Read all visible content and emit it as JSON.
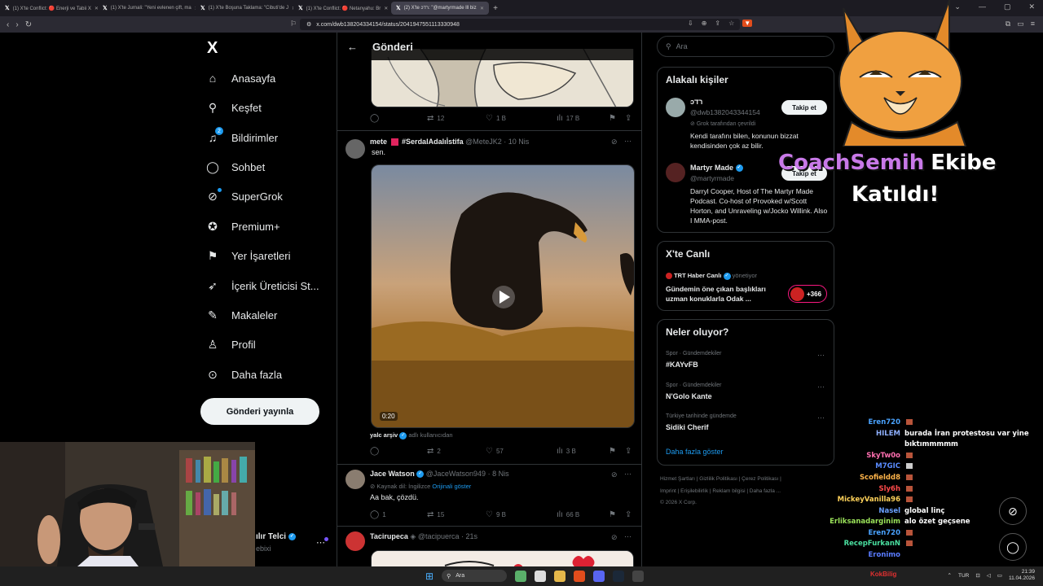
{
  "browser": {
    "tabs": [
      {
        "label": "(1) X'te Conflict: 🔴 Enerji ve Tabii X"
      },
      {
        "label": "(1) X'te Jurnali: \"Yeni evlenen çift, ma"
      },
      {
        "label": "(1) X'te Boşuna Taklama: \"Cibuti'de J"
      },
      {
        "label": "(1) X'te Conflict: 🔴 Netanyahu: Br"
      },
      {
        "label": "(2) X'te ɔרד: \"@martyrmade lll biz"
      }
    ],
    "url": "x.com/dwb1382043341​54/status/2041947551113330948"
  },
  "sidebar": {
    "logo": "X",
    "items": [
      {
        "label": "Anasayfa",
        "icon": "home-icon",
        "glyph": "⌂"
      },
      {
        "label": "Keşfet",
        "icon": "search-icon",
        "glyph": "⚲"
      },
      {
        "label": "Bildirimler",
        "icon": "bell-icon",
        "glyph": "🔔",
        "badge": "2"
      },
      {
        "label": "Sohbet",
        "icon": "chat-icon",
        "glyph": "◯"
      },
      {
        "label": "SuperGrok",
        "icon": "grok-icon",
        "glyph": "⊘"
      },
      {
        "label": "Premium+",
        "icon": "premium-icon",
        "glyph": "✪"
      },
      {
        "label": "Yer İşaretleri",
        "icon": "bookmark-icon",
        "glyph": "⚑"
      },
      {
        "label": "İçerik Üreticisi St...",
        "icon": "rocket-icon",
        "glyph": "➶"
      },
      {
        "label": "Makaleler",
        "icon": "article-icon",
        "glyph": "✎"
      },
      {
        "label": "Profil",
        "icon": "person-icon",
        "glyph": "👤"
      },
      {
        "label": "Daha fazla",
        "icon": "more-icon",
        "glyph": "⋯"
      }
    ],
    "post_button": "Gönderi yayınla",
    "account_name": "ılır Telci",
    "account_handle": "ebixi"
  },
  "main": {
    "header_title": "Gönderi",
    "top_post_actions": {
      "replies": "",
      "reposts": "12",
      "likes": "1 B",
      "views": "17 B"
    },
    "post1": {
      "name": "mete",
      "hashtag": "#SerdalAdalıİstifa",
      "handle": "@MeteJK2",
      "time": "10 Nis",
      "text": "sen.",
      "video_time": "0:20",
      "source_name": "yalc arşiv",
      "source_suffix": "adlı kullanıcıdan",
      "actions": {
        "replies": "",
        "reposts": "2",
        "likes": "57",
        "views": "3 B"
      }
    },
    "post2": {
      "name": "Jace Watson",
      "handle": "@JaceWatson949",
      "time": "8 Nis",
      "translate_note": "Kaynak dil: İngilizce",
      "translate_link": "Orijinali göster",
      "text": "Aa bak, çözdü.",
      "actions": {
        "replies": "1",
        "reposts": "15",
        "likes": "9 B",
        "views": "66 B"
      }
    },
    "post3": {
      "name": "Tacirupeca",
      "handle": "@tacipuerca",
      "time": "21s"
    }
  },
  "right": {
    "search_placeholder": "Ara",
    "related_title": "Alakalı kişiler",
    "person1": {
      "name": "ɔרד",
      "handle": "@dwb1382043344154",
      "grok_note": "Grok tarafından çevrildi",
      "bio": "Kendi tarafını bilen, konunun bizzat kendisinden çok az bilir.",
      "follow": "Takip et"
    },
    "person2": {
      "name": "Martyr Made",
      "handle": "@martyrmade",
      "bio": "Darryl Cooper, Host of The Martyr Made Podcast. Co-host of Provoked w/Scott Horton, and Unraveling w/Jocko Willink. Also I MMA-post.",
      "follow": "Takip et"
    },
    "live_title": "X'te Canlı",
    "live": {
      "channel": "TRT Haber Canlı",
      "role": "yönetiyor",
      "text": "Gündemin öne çıkan başlıkları uzman konuklarla Odak ...",
      "count": "+366"
    },
    "trends_title": "Neler oluyor?",
    "trends": [
      {
        "category": "Spor · Gündemdekiler",
        "name": "#KAYvFB"
      },
      {
        "category": "Spor · Gündemdekiler",
        "name": "N'Golo Kante"
      },
      {
        "category": "Türkiye tarihinde gündemde",
        "name": "Sidiki Cherif"
      }
    ],
    "show_more": "Daha fazla göster",
    "footer": {
      "line1": "Hizmet Şartları  |  Gizlilik Politikası  |  Çerez Politikası  |",
      "line2": "Imprint  |  Erişilebilirlik  |  Reklam bilgisi  |  Daha fazla ...",
      "line3": "© 2026 X Corp."
    }
  },
  "overlay": {
    "name": "CoachSemih",
    "text1": "Ekibe",
    "text2": "Katıldı!"
  },
  "chat": [
    {
      "name": "Eren720",
      "msg": "",
      "color": "#4aa3ff",
      "emoji": true
    },
    {
      "name": "HILEM",
      "msg": "burada İran protestosu var yine",
      "color": "#8fb0ff"
    },
    {
      "name": "",
      "msg": "bıktımmmmm",
      "color": "#fff"
    },
    {
      "name": "SkyTw0o",
      "msg": "",
      "color": "#ff6fb0",
      "emoji": true
    },
    {
      "name": "M7GIC",
      "msg": "",
      "color": "#5a8cff",
      "emoji": true
    },
    {
      "name": "Scofieldd8",
      "msg": "",
      "color": "#ffb44a",
      "emoji": true
    },
    {
      "name": "Sly6h",
      "msg": "",
      "color": "#ff4a4a",
      "emoji": true
    },
    {
      "name": "MickeyVanilla96",
      "msg": "",
      "color": "#ffd25a",
      "emoji": true
    },
    {
      "name": "Nasel",
      "msg": "global linç",
      "color": "#6aa0ff"
    },
    {
      "name": "Erliksanadarginim",
      "msg": "alo özet geçsene",
      "color": "#9be35a"
    },
    {
      "name": "Eren720",
      "msg": "",
      "color": "#4aa3ff",
      "emoji": true
    },
    {
      "name": "RecepFurkanN",
      "msg": "",
      "color": "#4ae0a0",
      "emoji": true
    },
    {
      "name": "Eronimo",
      "msg": "",
      "color": "#5a7cff"
    }
  ],
  "taskbar": {
    "search": "Ara",
    "streamer": "KokBilig",
    "lang": "TUR",
    "time": "21:39",
    "date": "11.04.2026"
  },
  "colors": {
    "accent": "#1d9bf0",
    "border": "#2f3336",
    "muted": "#71767b"
  }
}
